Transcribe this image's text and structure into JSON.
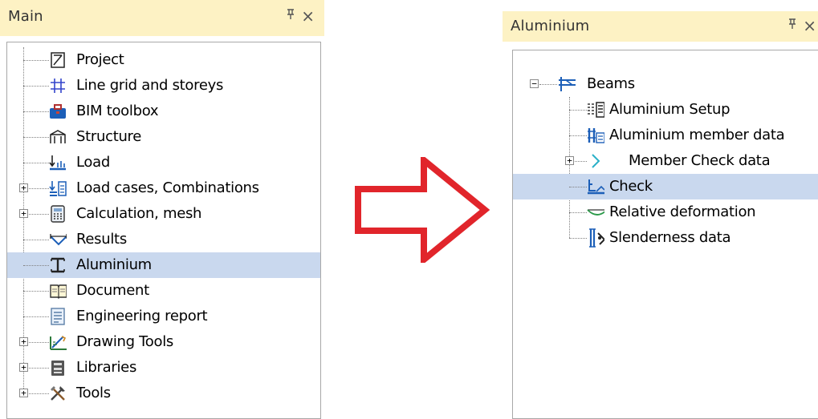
{
  "left_panel": {
    "title": "Main",
    "pin_glyph": "ᵖ",
    "close_glyph": "×",
    "items": [
      {
        "label": "Project",
        "icon": "project-icon",
        "expandable": false
      },
      {
        "label": "Line grid and storeys",
        "icon": "grid-icon",
        "expandable": false
      },
      {
        "label": "BIM toolbox",
        "icon": "toolbox-icon",
        "expandable": false
      },
      {
        "label": "Structure",
        "icon": "structure-icon",
        "expandable": false
      },
      {
        "label": "Load",
        "icon": "load-icon",
        "expandable": false
      },
      {
        "label": "Load cases, Combinations",
        "icon": "load-cases-icon",
        "expandable": true
      },
      {
        "label": "Calculation, mesh",
        "icon": "calculator-icon",
        "expandable": true
      },
      {
        "label": "Results",
        "icon": "results-icon",
        "expandable": false
      },
      {
        "label": "Aluminium",
        "icon": "aluminium-icon",
        "expandable": false,
        "selected": true
      },
      {
        "label": "Document",
        "icon": "document-icon",
        "expandable": false
      },
      {
        "label": "Engineering report",
        "icon": "report-icon",
        "expandable": false
      },
      {
        "label": "Drawing Tools",
        "icon": "drawing-tools-icon",
        "expandable": true
      },
      {
        "label": "Libraries",
        "icon": "libraries-icon",
        "expandable": true
      },
      {
        "label": "Tools",
        "icon": "tools-icon",
        "expandable": true
      }
    ]
  },
  "right_panel": {
    "title": "Aluminium",
    "pin_glyph": "ᵖ",
    "close_glyph": "×",
    "root": {
      "label": "Beams",
      "icon": "beams-icon",
      "expanded": true
    },
    "children": [
      {
        "label": "Aluminium Setup",
        "icon": "setup-icon",
        "expandable": false
      },
      {
        "label": "Aluminium member data",
        "icon": "member-data-icon",
        "expandable": false
      },
      {
        "label": "Member Check data",
        "icon": "member-check-icon",
        "expandable": true
      },
      {
        "label": "Check",
        "icon": "check-icon",
        "expandable": false,
        "selected": true
      },
      {
        "label": "Relative deformation",
        "icon": "deformation-icon",
        "expandable": false
      },
      {
        "label": "Slenderness data",
        "icon": "slenderness-icon",
        "expandable": false
      }
    ]
  },
  "colors": {
    "title_bg": "#fdf2c4",
    "selection": "#c9d8ee",
    "arrow": "#e1252b"
  }
}
